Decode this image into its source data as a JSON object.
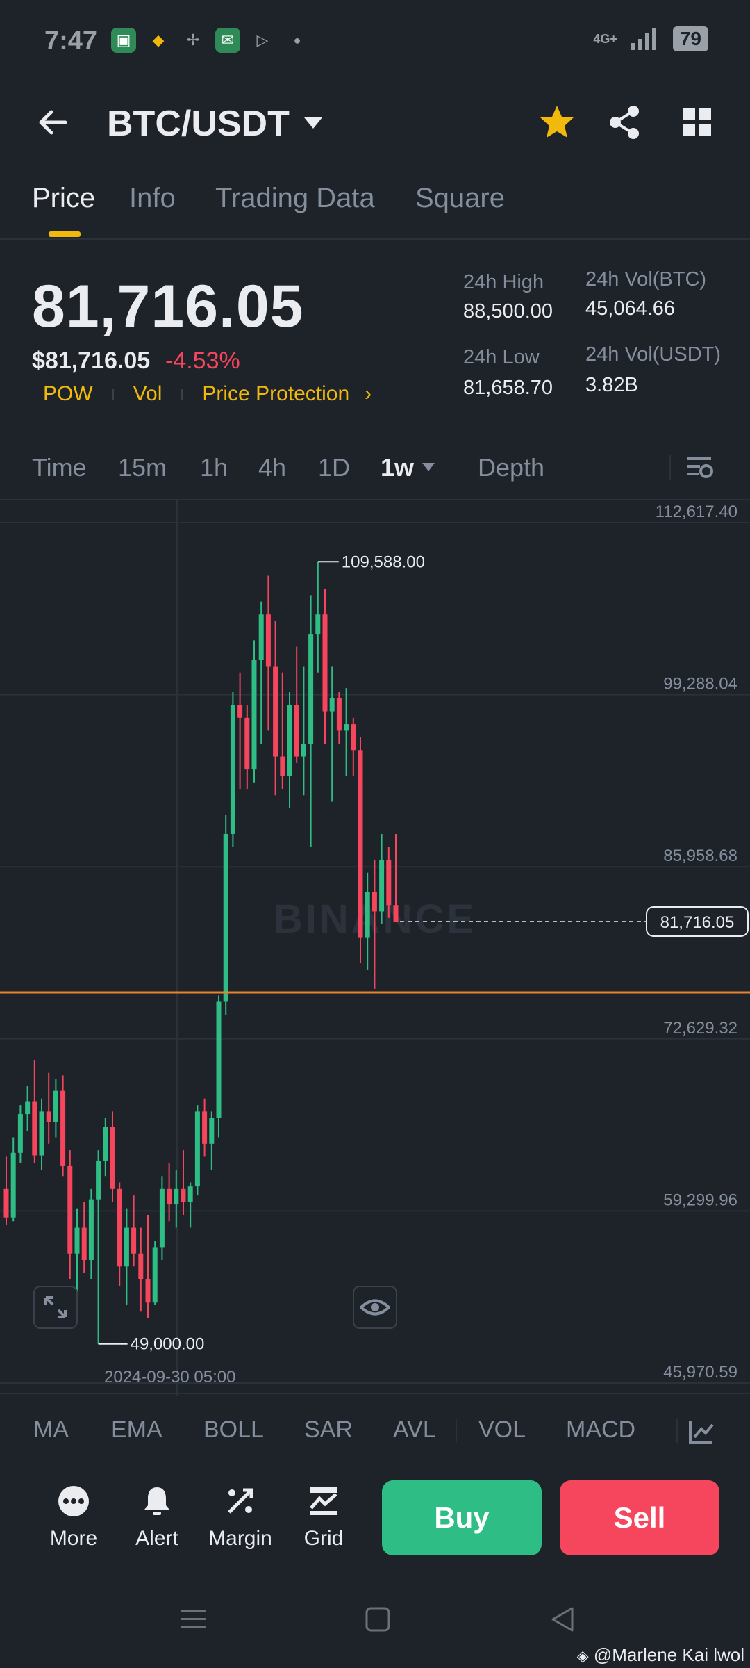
{
  "status": {
    "time": "7:47",
    "network": "4G+",
    "battery": "79"
  },
  "header": {
    "title": "BTC/USDT"
  },
  "tabs": [
    {
      "label": "Price"
    },
    {
      "label": "Info"
    },
    {
      "label": "Trading Data"
    },
    {
      "label": "Square"
    }
  ],
  "price": {
    "last": "81,716.05",
    "usd": "$81,716.05",
    "change": "-4.53%",
    "tags": [
      "POW",
      "Vol",
      "Price Protection"
    ]
  },
  "stats": {
    "high_label": "24h High",
    "high_value": "88,500.00",
    "low_label": "24h Low",
    "low_value": "81,658.70",
    "vol_btc_label": "24h Vol(BTC)",
    "vol_btc_value": "45,064.66",
    "vol_usdt_label": "24h Vol(USDT)",
    "vol_usdt_value": "3.82B"
  },
  "intervals": [
    "Time",
    "15m",
    "1h",
    "4h",
    "1D",
    "1w",
    "Depth"
  ],
  "chart": {
    "y_ticks": [
      "112,617.40",
      "99,288.04",
      "85,958.68",
      "72,629.32",
      "59,299.96",
      "45,970.59"
    ],
    "max_label": "109,588.00",
    "min_label": "49,000.00",
    "current_label": "81,716.05",
    "x_label": "2024-09-30 05:00",
    "watermark": "BINANCE"
  },
  "chart_data": {
    "type": "candlestick",
    "ylim": [
      45970.59,
      112617.4
    ],
    "max": 109588.0,
    "min": 49000.0,
    "current": 81716.05,
    "x_label": "2024-09-30 05:00",
    "candles": [
      {
        "o": 61000,
        "h": 63500,
        "l": 58200,
        "c": 58800
      },
      {
        "o": 58800,
        "h": 65000,
        "l": 58500,
        "c": 63800
      },
      {
        "o": 63800,
        "h": 67500,
        "l": 63000,
        "c": 66800
      },
      {
        "o": 66800,
        "h": 69000,
        "l": 65500,
        "c": 67800
      },
      {
        "o": 67800,
        "h": 71000,
        "l": 63000,
        "c": 63600
      },
      {
        "o": 63600,
        "h": 68000,
        "l": 62500,
        "c": 67000
      },
      {
        "o": 67000,
        "h": 70000,
        "l": 64500,
        "c": 66200
      },
      {
        "o": 66200,
        "h": 69500,
        "l": 65000,
        "c": 68600
      },
      {
        "o": 68600,
        "h": 69800,
        "l": 62000,
        "c": 62800
      },
      {
        "o": 62800,
        "h": 64000,
        "l": 54000,
        "c": 56000
      },
      {
        "o": 56000,
        "h": 59500,
        "l": 53000,
        "c": 58000
      },
      {
        "o": 58000,
        "h": 60000,
        "l": 54500,
        "c": 55500
      },
      {
        "o": 55500,
        "h": 61000,
        "l": 54000,
        "c": 60200
      },
      {
        "o": 60200,
        "h": 64000,
        "l": 49000,
        "c": 63200
      },
      {
        "o": 63200,
        "h": 66500,
        "l": 62000,
        "c": 65800
      },
      {
        "o": 65800,
        "h": 67000,
        "l": 60000,
        "c": 61000
      },
      {
        "o": 61000,
        "h": 61500,
        "l": 53500,
        "c": 55000
      },
      {
        "o": 55000,
        "h": 59500,
        "l": 52000,
        "c": 58000
      },
      {
        "o": 58000,
        "h": 60500,
        "l": 55000,
        "c": 56000
      },
      {
        "o": 56000,
        "h": 58000,
        "l": 51500,
        "c": 54000
      },
      {
        "o": 54000,
        "h": 59000,
        "l": 51000,
        "c": 52200
      },
      {
        "o": 52200,
        "h": 57000,
        "l": 52000,
        "c": 56500
      },
      {
        "o": 56500,
        "h": 62000,
        "l": 55500,
        "c": 61000
      },
      {
        "o": 61000,
        "h": 63000,
        "l": 58500,
        "c": 59800
      },
      {
        "o": 59800,
        "h": 62500,
        "l": 58000,
        "c": 61000
      },
      {
        "o": 61000,
        "h": 64000,
        "l": 59000,
        "c": 60000
      },
      {
        "o": 60000,
        "h": 61500,
        "l": 58000,
        "c": 61200
      },
      {
        "o": 61200,
        "h": 67500,
        "l": 60500,
        "c": 67000
      },
      {
        "o": 67000,
        "h": 68000,
        "l": 63500,
        "c": 64500
      },
      {
        "o": 64500,
        "h": 67000,
        "l": 62500,
        "c": 66500
      },
      {
        "o": 66500,
        "h": 76000,
        "l": 65000,
        "c": 75500
      },
      {
        "o": 75500,
        "h": 90000,
        "l": 74500,
        "c": 88500
      },
      {
        "o": 88500,
        "h": 99500,
        "l": 87500,
        "c": 98500
      },
      {
        "o": 98500,
        "h": 101000,
        "l": 92000,
        "c": 97500
      },
      {
        "o": 97500,
        "h": 98500,
        "l": 92000,
        "c": 93500
      },
      {
        "o": 93500,
        "h": 103500,
        "l": 92500,
        "c": 102000
      },
      {
        "o": 102000,
        "h": 106500,
        "l": 95500,
        "c": 105500
      },
      {
        "o": 105500,
        "h": 108500,
        "l": 96500,
        "c": 101500
      },
      {
        "o": 101500,
        "h": 105000,
        "l": 91500,
        "c": 94500
      },
      {
        "o": 94500,
        "h": 101000,
        "l": 92000,
        "c": 93000
      },
      {
        "o": 93000,
        "h": 99500,
        "l": 90500,
        "c": 98500
      },
      {
        "o": 98500,
        "h": 103000,
        "l": 94000,
        "c": 94500
      },
      {
        "o": 94500,
        "h": 101500,
        "l": 91500,
        "c": 95500
      },
      {
        "o": 95500,
        "h": 107000,
        "l": 87500,
        "c": 104000
      },
      {
        "o": 104000,
        "h": 109588,
        "l": 101000,
        "c": 105500
      },
      {
        "o": 105500,
        "h": 107500,
        "l": 95500,
        "c": 98000
      },
      {
        "o": 98000,
        "h": 101500,
        "l": 91000,
        "c": 99000
      },
      {
        "o": 99000,
        "h": 99500,
        "l": 95500,
        "c": 96500
      },
      {
        "o": 96500,
        "h": 99800,
        "l": 93000,
        "c": 97000
      },
      {
        "o": 97000,
        "h": 97500,
        "l": 93000,
        "c": 95000
      },
      {
        "o": 95000,
        "h": 96000,
        "l": 78500,
        "c": 80500
      },
      {
        "o": 80500,
        "h": 85500,
        "l": 78000,
        "c": 84000
      },
      {
        "o": 84000,
        "h": 86500,
        "l": 76500,
        "c": 82500
      },
      {
        "o": 82500,
        "h": 88500,
        "l": 81500,
        "c": 86500
      },
      {
        "o": 86500,
        "h": 87500,
        "l": 82000,
        "c": 83000
      },
      {
        "o": 83000,
        "h": 88500,
        "l": 81658,
        "c": 81716
      }
    ]
  },
  "indicators": [
    "MA",
    "EMA",
    "BOLL",
    "SAR",
    "AVL",
    "VOL",
    "MACD"
  ],
  "actions": [
    {
      "label": "More"
    },
    {
      "label": "Alert"
    },
    {
      "label": "Margin"
    },
    {
      "label": "Grid"
    }
  ],
  "trade": {
    "buy": "Buy",
    "sell": "Sell"
  },
  "credit": "@Marlene Kai lwol",
  "colors": {
    "up": "#2ebd85",
    "down": "#f6465d",
    "accent": "#f0b90b",
    "bg": "#1e2229"
  }
}
